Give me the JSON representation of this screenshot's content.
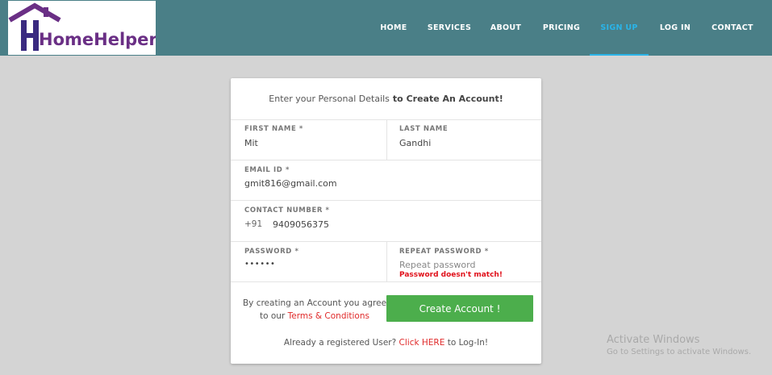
{
  "brand": {
    "name": "HomeHelpers",
    "primary_color": "#6a2f85"
  },
  "nav": {
    "items": [
      "HOME",
      "SERVICES",
      "ABOUT",
      "PRICING",
      "SIGN UP",
      "LOG IN",
      "CONTACT"
    ],
    "active": "SIGN UP",
    "bar_color": "#4a7f87",
    "active_color": "#2ab4e8"
  },
  "form": {
    "title_prefix": "Enter your Personal Details",
    "title_bold": "to Create An Account!",
    "first_name": {
      "label": "FIRST NAME *",
      "value": "Mit"
    },
    "last_name": {
      "label": "LAST NAME",
      "value": "Gandhi"
    },
    "email": {
      "label": "EMAIL ID *",
      "value": "gmit816@gmail.com"
    },
    "contact": {
      "label": "CONTACT NUMBER *",
      "code": "+91",
      "value": "9409056375"
    },
    "password": {
      "label": "PASSWORD *",
      "value": "••••••"
    },
    "repeat_password": {
      "label": "REPEAT PASSWORD *",
      "placeholder": "Repeat password",
      "error": "Password doesn't match!"
    },
    "agree_prefix": "By creating an Account you agree to our",
    "terms_link": "Terms & Conditions",
    "submit_label": "Create Account !",
    "submit_color": "#4cae4c",
    "already_prefix": "Already a registered User?",
    "login_link": "Click HERE",
    "already_suffix": "to Log-In!"
  },
  "watermark": {
    "title": "Activate Windows",
    "subtitle": "Go to Settings to activate Windows."
  }
}
